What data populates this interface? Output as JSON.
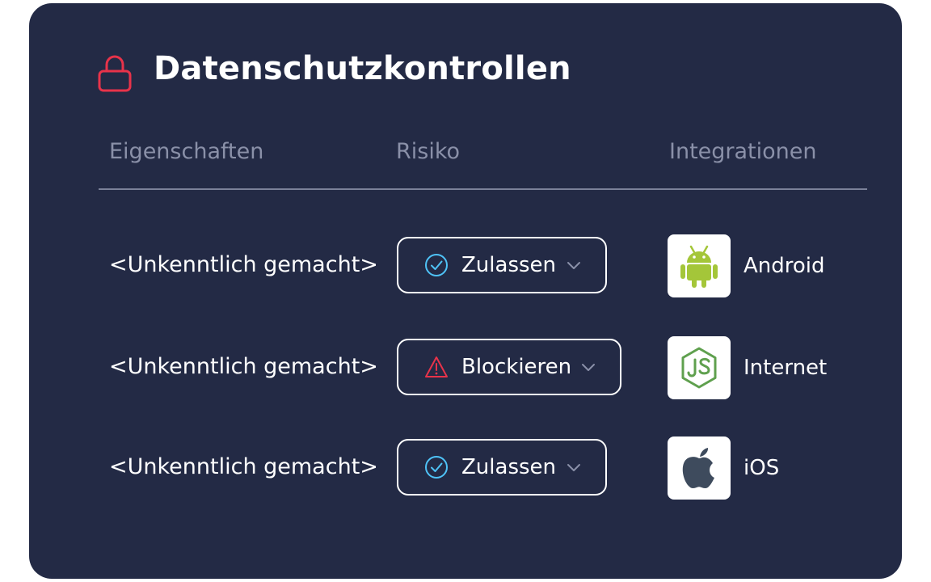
{
  "panel": {
    "title": "Datenschutzkontrollen",
    "lock_icon": "lock-icon",
    "accent_color": "#e8334a"
  },
  "columns": {
    "properties": "Eigenschaften",
    "risk": "Risiko",
    "integrations": "Integrationen"
  },
  "rows": [
    {
      "property": "<Unkenntlich gemacht>",
      "risk": {
        "label": "Zulassen",
        "icon": "check-circle-icon",
        "color": "#4fc3f7"
      },
      "integration": {
        "label": "Android",
        "icon": "android-icon"
      }
    },
    {
      "property": "<Unkenntlich gemacht>",
      "risk": {
        "label": "Blockieren",
        "icon": "warning-icon",
        "color": "#e8334a"
      },
      "integration": {
        "label": "Internet",
        "icon": "nodejs-icon"
      }
    },
    {
      "property": "<Unkenntlich gemacht>",
      "risk": {
        "label": "Zulassen",
        "icon": "check-circle-icon",
        "color": "#4fc3f7"
      },
      "integration": {
        "label": "iOS",
        "icon": "apple-icon"
      }
    }
  ]
}
